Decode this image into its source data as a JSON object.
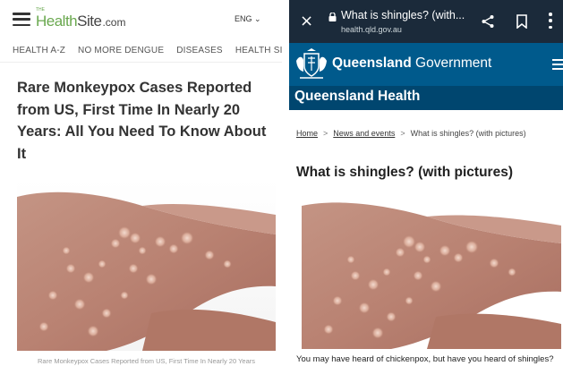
{
  "left": {
    "logo": {
      "prefix": "THE",
      "health": "Health",
      "site": "Site",
      "tld": ".com"
    },
    "language": "ENG ⌄",
    "nav": [
      "HEALTH A-Z",
      "NO MORE DENGUE",
      "DISEASES",
      "HEALTH SI"
    ],
    "headline": "Rare Monkeypox Cases Reported from US, First Time In Nearly 20 Years: All You Need To Know About It",
    "caption": "Rare Monkeypox Cases Reported from US, First Time In Nearly 20 Years"
  },
  "right": {
    "browser": {
      "close_icon": "×",
      "title": "What is shingles? (with...",
      "url": "health.qld.gov.au"
    },
    "gov_banner": {
      "bold": "Queensland",
      "rest": " Government"
    },
    "dept": "Queensland Health",
    "breadcrumb": [
      "Home",
      "News and events",
      "What is shingles? (with pictures)"
    ],
    "heading": "What is shingles? (with pictures)",
    "paragraph": "You may have heard of chickenpox, but have you heard of shingles?"
  },
  "colors": {
    "browser_bar": "#1b2a3a",
    "qld_blue": "#005a8c",
    "qld_dark": "#00466f",
    "logo_green": "#6aa84f"
  }
}
